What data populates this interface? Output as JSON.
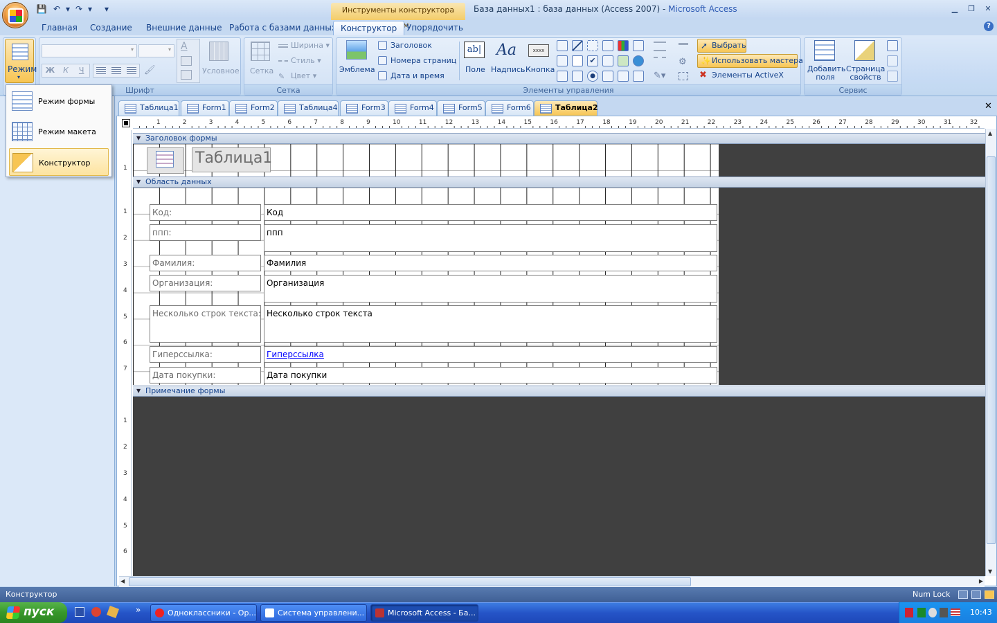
{
  "window": {
    "context_tools": "Инструменты конструктора форм",
    "title_doc": "База данных1 : база данных (Access 2007) - ",
    "title_app": "Microsoft Access",
    "minimize": "▁",
    "restore": "❐",
    "close": "✕"
  },
  "qat": {
    "save": "💾",
    "undo": "↶",
    "redo": "↷",
    "more": "▾"
  },
  "tabs": [
    {
      "label": "Главная"
    },
    {
      "label": "Создание"
    },
    {
      "label": "Внешние данные"
    },
    {
      "label": "Работа с базами данных"
    },
    {
      "label": "Конструктор"
    },
    {
      "label": "Упорядочить"
    }
  ],
  "help": "?",
  "ribbon": {
    "views": {
      "label": "Режим"
    },
    "font": {
      "group": "Шрифт",
      "bold": "Ж",
      "italic": "К",
      "underline": "Ч",
      "conditional": "Условное"
    },
    "grid": {
      "group": "Сетка",
      "grid": "Сетка",
      "width": "Ширина",
      "style": "Стиль",
      "color": "Цвет"
    },
    "controls": {
      "group": "Элементы управления",
      "logo": "Эмблема",
      "title": "Заголовок",
      "page_numbers": "Номера страниц",
      "date_time": "Дата и время",
      "textbox": "Поле",
      "label": "Надпись",
      "button": "Кнопка",
      "select": "Выбрать",
      "wizards": "Использовать мастера",
      "activex": "Элементы ActiveX"
    },
    "tools": {
      "group": "Сервис",
      "add_fields": "Добавить поля",
      "add_fields_l1": "Добавить",
      "add_fields_l2": "поля",
      "property_sheet_l1": "Страница",
      "property_sheet_l2": "свойств"
    }
  },
  "mode_menu": [
    {
      "label": "Режим формы"
    },
    {
      "label": "Режим макета"
    },
    {
      "label": "Конструктор"
    }
  ],
  "doc_tabs": [
    {
      "label": "Таблица1"
    },
    {
      "label": "Form1"
    },
    {
      "label": "Form2"
    },
    {
      "label": "Таблица4"
    },
    {
      "label": "Form3"
    },
    {
      "label": "Form4"
    },
    {
      "label": "Form5"
    },
    {
      "label": "Form6"
    },
    {
      "label": "Таблица2"
    }
  ],
  "doc_close": "✕",
  "design": {
    "header_section": "Заголовок формы",
    "detail_section": "Область данных",
    "footer_section": "Примечание формы",
    "form_title": "Таблица1",
    "fields": [
      {
        "label": "Код:",
        "value": "Код"
      },
      {
        "label": "ппп:",
        "value": "ппп"
      },
      {
        "label": "Фамилия:",
        "value": "Фамилия"
      },
      {
        "label": "Организация:",
        "value": "Организация"
      },
      {
        "label": "Несколько строк текста:",
        "value": "Несколько строк текста"
      },
      {
        "label": "Гиперссылка:",
        "value": "Гиперссылка"
      },
      {
        "label": "Дата покупки:",
        "value": "Дата покупки"
      }
    ],
    "ruler_ticks": [
      "1",
      "2",
      "3",
      "4",
      "5",
      "6",
      "7",
      "8",
      "9",
      "10",
      "11",
      "12",
      "13",
      "14",
      "15",
      "16",
      "17",
      "18",
      "19",
      "20",
      "21",
      "22",
      "23",
      "24",
      "25",
      "26",
      "27",
      "28",
      "29",
      "30",
      "31",
      "32"
    ]
  },
  "status": {
    "left": "Конструктор",
    "numlock": "Num Lock"
  },
  "taskbar": {
    "start": "пуск",
    "more": "»",
    "items": [
      {
        "label": "Одноклассники - Ор..."
      },
      {
        "label": "Система управлени..."
      },
      {
        "label": "Microsoft Access - Ба..."
      }
    ],
    "clock": "10:43"
  },
  "colors": {
    "accent_tab": "#f7c553",
    "taskbar": "#2554c7",
    "start": "#37972a"
  }
}
